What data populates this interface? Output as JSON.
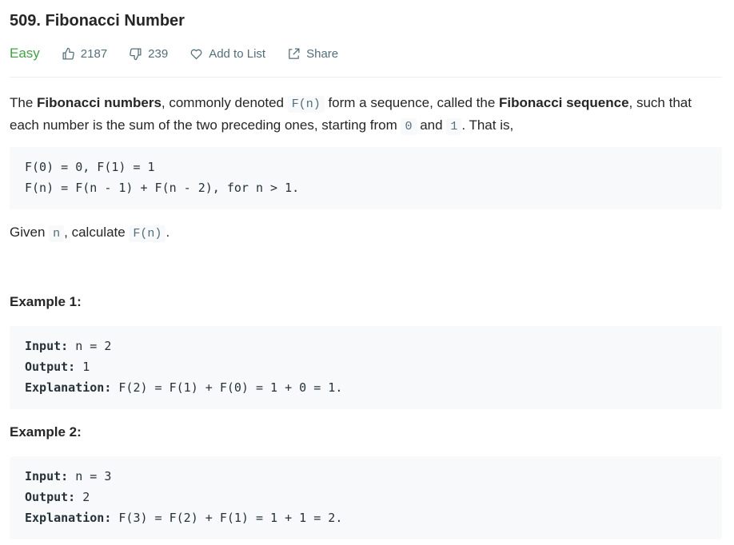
{
  "problem": {
    "title": "509. Fibonacci Number",
    "difficulty": "Easy",
    "likes": "2187",
    "dislikes": "239",
    "add_to_list": "Add to List",
    "share": "Share"
  },
  "description": {
    "p1": {
      "t1": "The ",
      "b1": "Fibonacci numbers",
      "t2": ", commonly denoted ",
      "c1": "F(n)",
      "t3": " form a sequence, called the ",
      "b2": "Fibonacci sequence",
      "t4": ", such that each number is the sum of the two preceding ones, starting from ",
      "c2": "0",
      "t5": " and ",
      "c3": "1",
      "t6": ". That is,"
    },
    "formula": [
      "F(0) = 0, F(1) = 1",
      "F(n) = F(n - 1) + F(n - 2), for n > 1."
    ],
    "given": {
      "t1": "Given ",
      "c1": "n",
      "t2": ", calculate ",
      "c2": "F(n)",
      "t3": "."
    }
  },
  "examples": [
    {
      "title": "Example 1:",
      "input_label": "Input:",
      "input_value": " n = 2",
      "output_label": "Output:",
      "output_value": " 1",
      "explanation_label": "Explanation:",
      "explanation_value": " F(2) = F(1) + F(0) = 1 + 0 = 1."
    },
    {
      "title": "Example 2:",
      "input_label": "Input:",
      "input_value": " n = 3",
      "output_label": "Output:",
      "output_value": " 2",
      "explanation_label": "Explanation:",
      "explanation_value": " F(3) = F(2) + F(1) = 1 + 1 = 2."
    }
  ],
  "colors": {
    "easy": "#43a047",
    "meta": "#546e7a",
    "code_bg": "#f7f9fa"
  },
  "icons": [
    "thumbs-up-icon",
    "thumbs-down-icon",
    "heart-icon",
    "share-icon"
  ]
}
